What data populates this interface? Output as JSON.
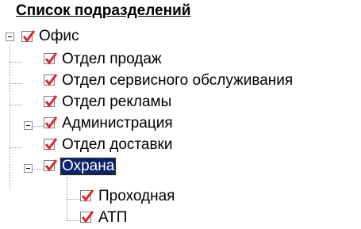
{
  "header": {
    "title": "Список подразделений"
  },
  "tree": {
    "root": {
      "label": "Офис",
      "expanded": true,
      "checked": true
    },
    "items": [
      {
        "label": "Отдел продаж",
        "checked": true
      },
      {
        "label": "Отдел сервисного обслуживания",
        "checked": true
      },
      {
        "label": "Отдел рекламы",
        "checked": true
      },
      {
        "label": "Администрация",
        "checked": true,
        "expanded": true
      },
      {
        "label": "Отдел доставки",
        "checked": true
      },
      {
        "label": "Охрана",
        "checked": true,
        "expanded": true,
        "selected": true,
        "children": [
          {
            "label": "Проходная",
            "checked": true
          },
          {
            "label": "АТП",
            "checked": true
          }
        ]
      }
    ]
  },
  "colors": {
    "check": "#e0262a",
    "selection_bg": "#0a246a",
    "selection_fg": "#ffffff"
  },
  "icons": {
    "expander": "minus-box-icon",
    "checkbox": "checkmark-icon"
  }
}
